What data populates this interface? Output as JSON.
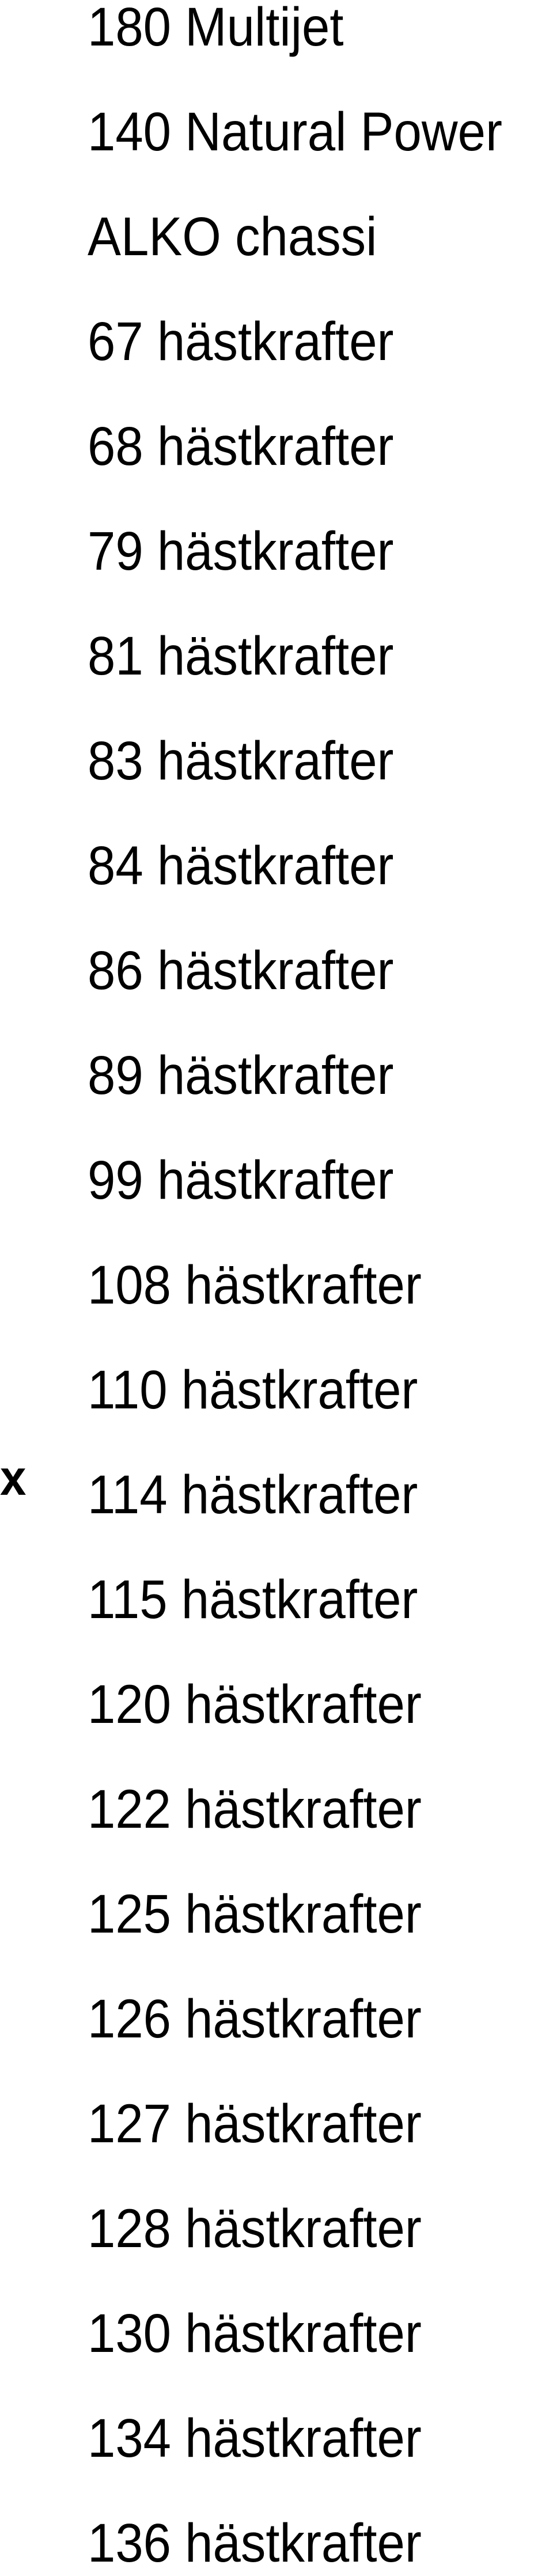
{
  "document": {
    "items": [
      {
        "label": "180 Multijet",
        "marked": false
      },
      {
        "label": "140 Natural Power",
        "marked": false
      },
      {
        "label": "ALKO chassi",
        "marked": false
      },
      {
        "label": "67 hästkrafter",
        "marked": false
      },
      {
        "label": "68 hästkrafter",
        "marked": false
      },
      {
        "label": "79 hästkrafter",
        "marked": false
      },
      {
        "label": "81 hästkrafter",
        "marked": false
      },
      {
        "label": "83 hästkrafter",
        "marked": false
      },
      {
        "label": "84 hästkrafter",
        "marked": false
      },
      {
        "label": "86 hästkrafter",
        "marked": false
      },
      {
        "label": "89 hästkrafter",
        "marked": false
      },
      {
        "label": "99 hästkrafter",
        "marked": false
      },
      {
        "label": "108 hästkrafter",
        "marked": false
      },
      {
        "label": "110 hästkrafter",
        "marked": false
      },
      {
        "label": "114 hästkrafter",
        "marked": true,
        "marker": "x"
      },
      {
        "label": "115 hästkrafter",
        "marked": false
      },
      {
        "label": "120 hästkrafter",
        "marked": false
      },
      {
        "label": "122 hästkrafter",
        "marked": false
      },
      {
        "label": "125 hästkrafter",
        "marked": false
      },
      {
        "label": "126 hästkrafter",
        "marked": false
      },
      {
        "label": "127 hästkrafter",
        "marked": false
      },
      {
        "label": "128 hästkrafter",
        "marked": false
      },
      {
        "label": "130 hästkrafter",
        "marked": false
      },
      {
        "label": "134 hästkrafter",
        "marked": false
      },
      {
        "label": "136 hästkrafter",
        "marked": false
      }
    ]
  }
}
